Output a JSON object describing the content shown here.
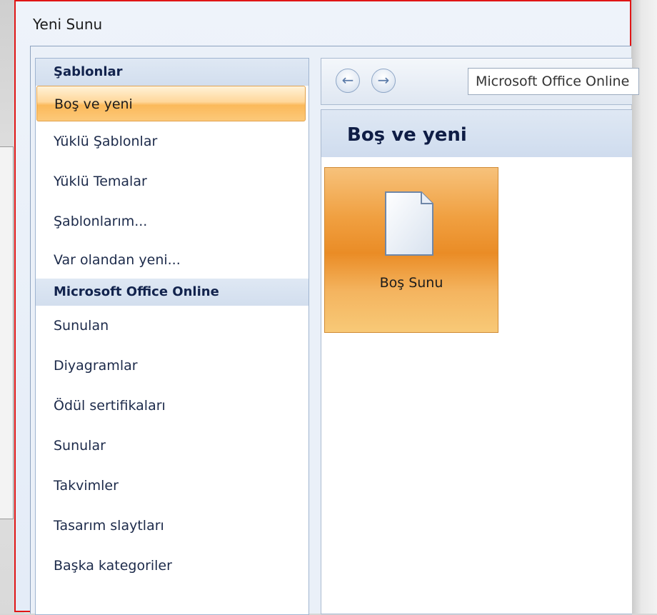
{
  "dialog": {
    "title": "Yeni Sunu"
  },
  "sidebar": {
    "header_templates": "Şablonlar",
    "items": [
      {
        "label": "Boş ve yeni",
        "selected": true
      },
      {
        "label": "Yüklü Şablonlar"
      },
      {
        "label": "Yüklü Temalar"
      },
      {
        "label": "Şablonlarım..."
      },
      {
        "label": "Var olandan yeni..."
      }
    ],
    "header_online": "Microsoft Office Online",
    "online_items": [
      {
        "label": "Sunulan"
      },
      {
        "label": "Diyagramlar"
      },
      {
        "label": "Ödül sertifikaları"
      },
      {
        "label": "Sunular"
      },
      {
        "label": "Takvimler"
      },
      {
        "label": "Tasarım slaytları"
      },
      {
        "label": "Başka kategoriler"
      }
    ]
  },
  "navbar": {
    "back_icon": "arrow-left-icon",
    "forward_icon": "arrow-right-icon",
    "address_text": "Microsoft Office Online"
  },
  "content": {
    "header": "Boş ve yeni",
    "tiles": [
      {
        "label": "Boş Sunu",
        "icon": "blank-document-icon",
        "selected": true
      }
    ]
  },
  "colors": {
    "selection_orange": "#f0a041",
    "header_text": "#0f1d45",
    "highlight_border": "#e01515"
  }
}
